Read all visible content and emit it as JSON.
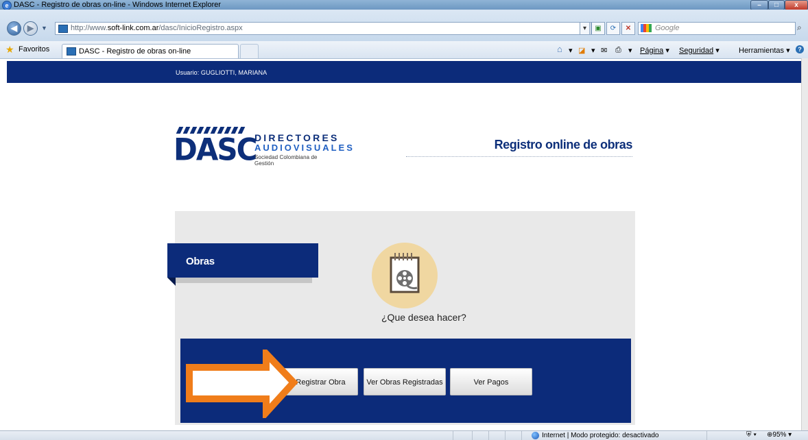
{
  "window": {
    "title": "DASC - Registro de obras on-line - Windows Internet Explorer",
    "minimize": "–",
    "maximize": "□",
    "close": "x"
  },
  "address_bar": {
    "url_prefix": "http://www.",
    "url_domain": "soft-link.com.ar",
    "url_path": "/dasc/InicioRegistro.aspx",
    "search_placeholder": "Google"
  },
  "favorites_bar": {
    "favorites_label": "Favoritos",
    "tab_title": "DASC - Registro de obras on-line",
    "commands": {
      "page": "Página",
      "safety": "Seguridad",
      "tools": "Herramientas"
    }
  },
  "page": {
    "user_label": "Usuario: GUGLIOTTI, MARIANA",
    "logo": {
      "brand": "DASC",
      "line1": "DIRECTORES",
      "line2": "AUDIOVISUALES",
      "line3": "Sociedad Colombiana de Gestión"
    },
    "heading": "Registro online de obras",
    "section_tab": "Obras",
    "prompt": "¿Que desea hacer?",
    "buttons": {
      "register": "Registrar Obra",
      "view_registered": "Ver Obras Registradas",
      "view_payments": "Ver Pagos"
    }
  },
  "status_bar": {
    "zone": "Internet | Modo protegido: desactivado",
    "zoom": "95%"
  },
  "colors": {
    "brand_navy": "#0c2b7a",
    "arrow_orange": "#f07d1a",
    "panel_gray": "#e9e9e9",
    "icon_circle": "#f0d7a1"
  }
}
